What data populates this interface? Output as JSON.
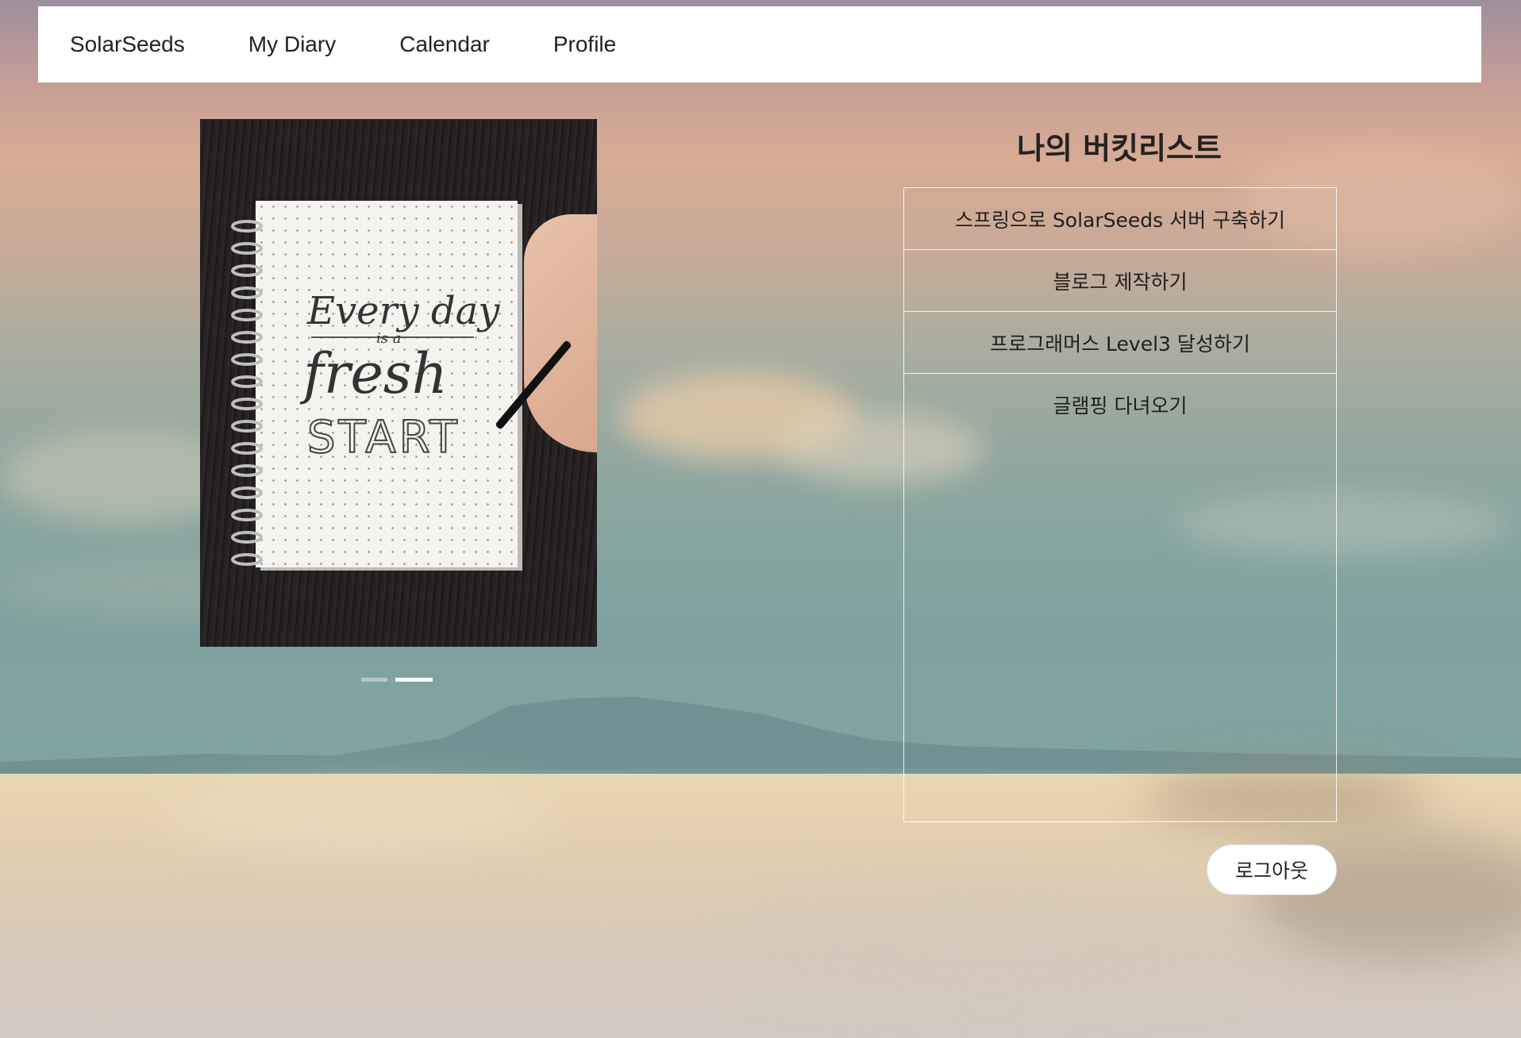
{
  "navbar": {
    "brand": "SolarSeeds",
    "links": [
      "My Diary",
      "Calendar",
      "Profile"
    ]
  },
  "carousel": {
    "slide_count": 2,
    "active_slide": 2,
    "photo_text": [
      "Every day",
      "is a",
      "fresh",
      "START"
    ]
  },
  "bucket": {
    "title": "나의 버킷리스트",
    "items": [
      "스프링으로 SolarSeeds 서버 구축하기",
      "블로그 제작하기",
      "프로그래머스 Level3 달성하기",
      "글램핑 다녀오기"
    ]
  },
  "logout_label": "로그아웃",
  "colors": {
    "navbar_bg": "#ffffff",
    "text": "#222222"
  }
}
